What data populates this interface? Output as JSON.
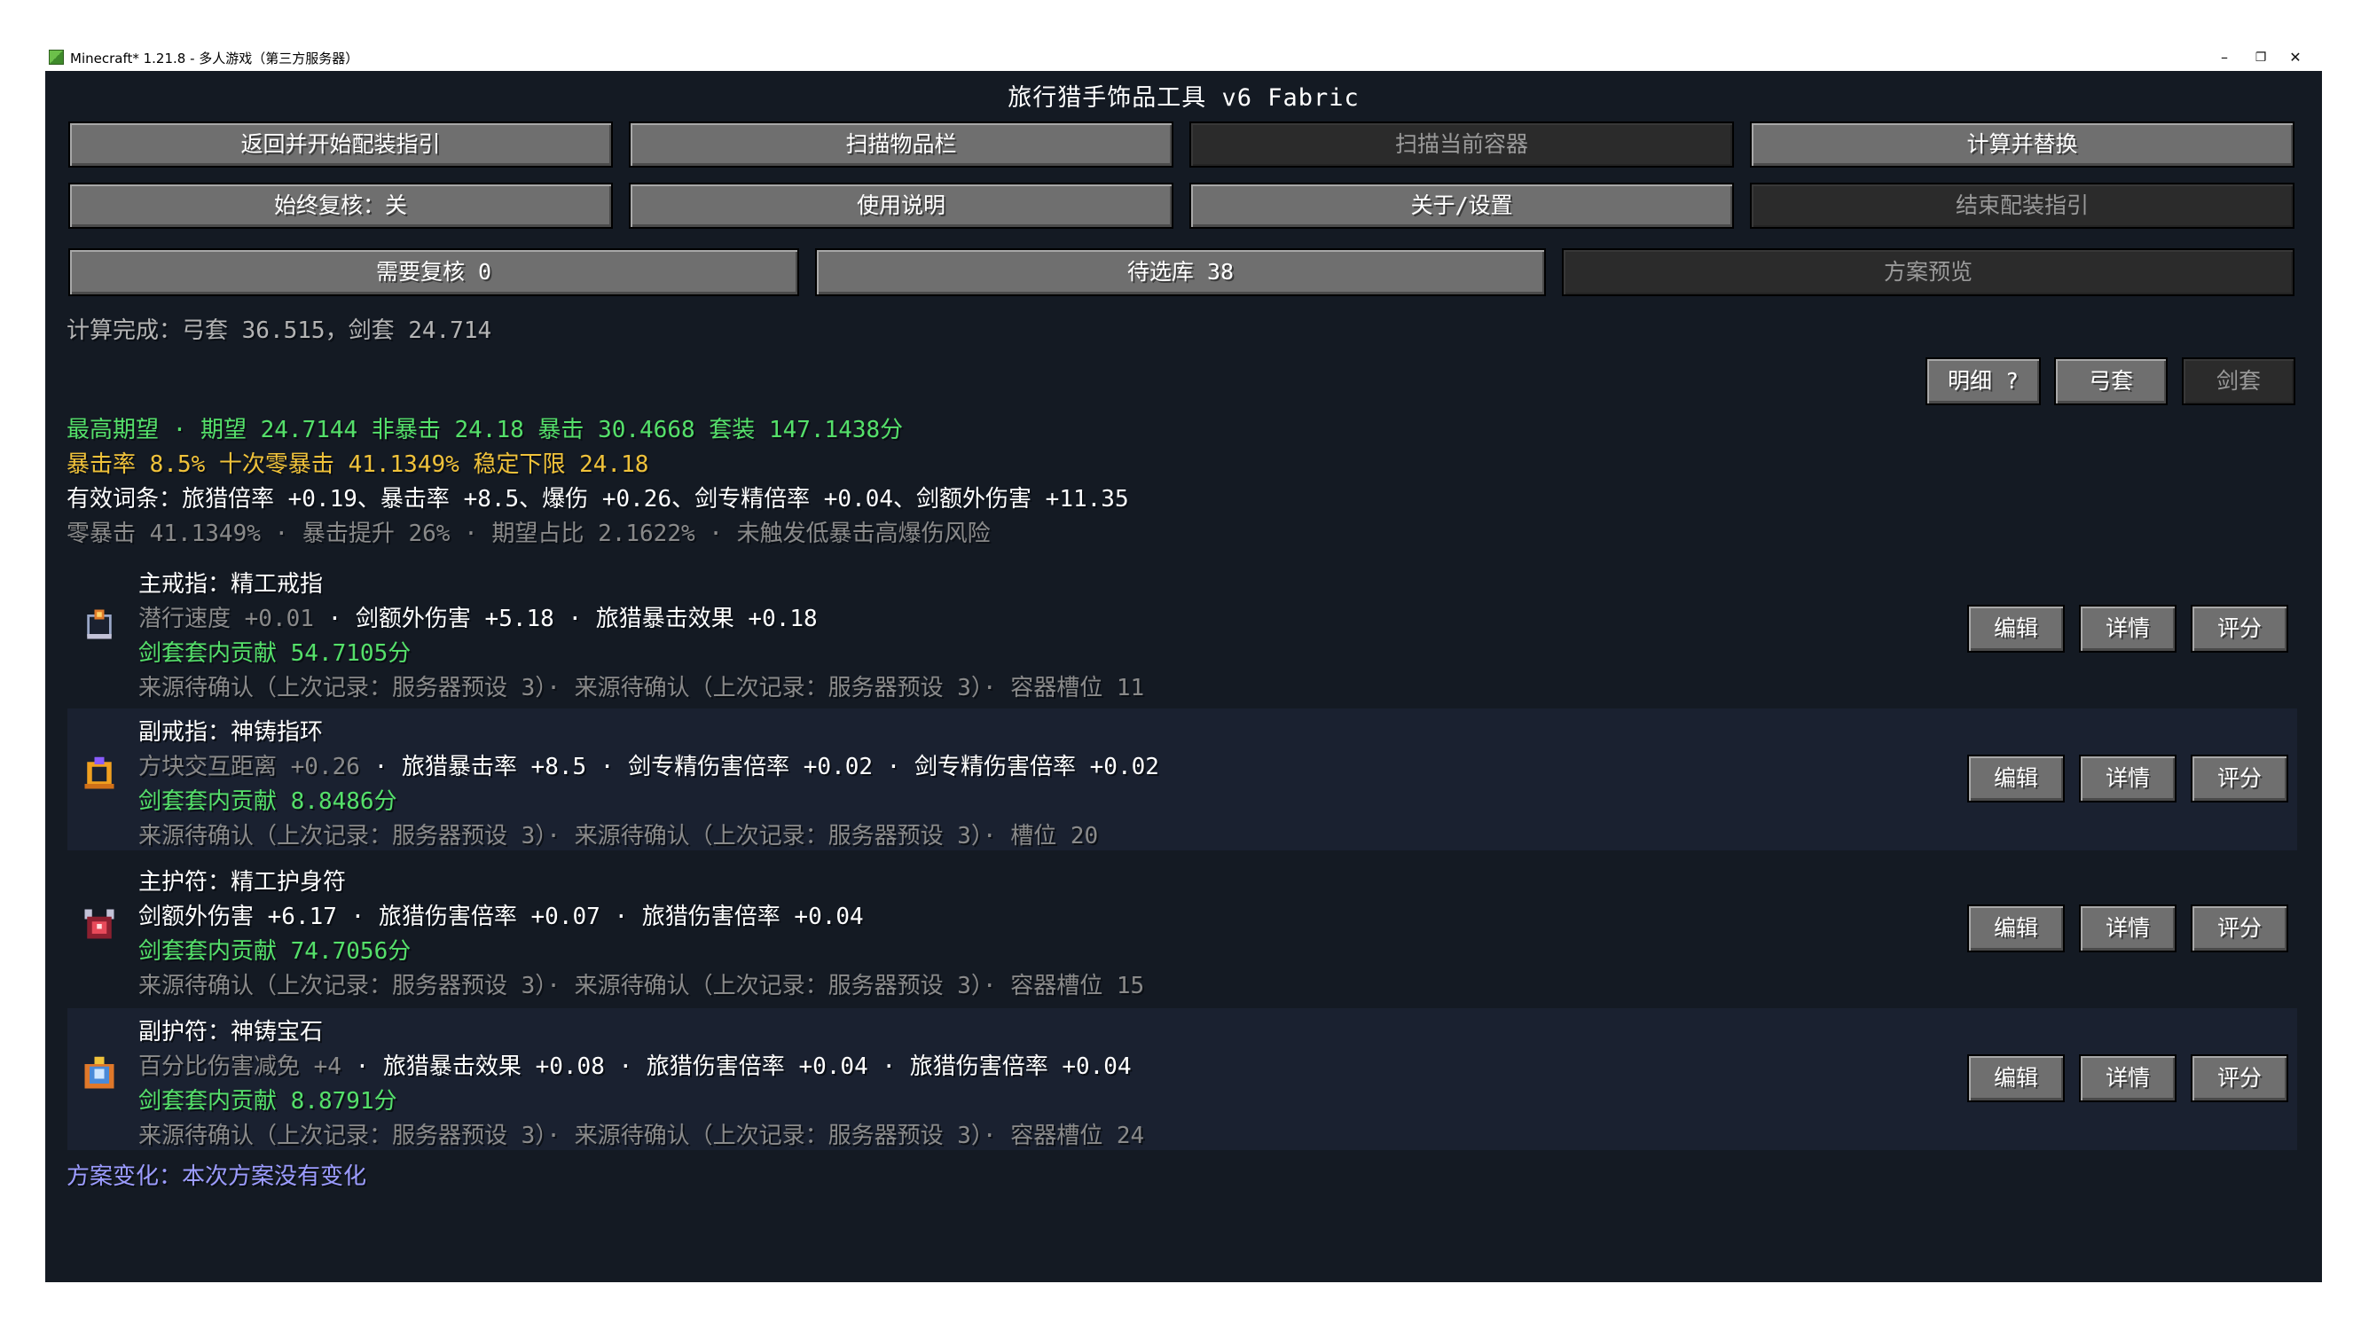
{
  "window": {
    "title": "Minecraft* 1.21.8 - 多人游戏（第三方服务器）",
    "minimize": "–",
    "restore": "❐",
    "close": "✕"
  },
  "screen": {
    "title": "旅行猎手饰品工具 v6 Fabric"
  },
  "buttons": {
    "return_guide": "返回并开始配装指引",
    "scan_inventory": "扫描物品栏",
    "scan_container": "扫描当前容器",
    "calc_replace": "计算并替换",
    "always_review": "始终复核：关",
    "usage": "使用说明",
    "about_settings": "关于/设置",
    "end_guide": "结束配装指引",
    "need_review": "需要复核 0",
    "candidates": "待选库 38",
    "plan_preview": "方案预览",
    "detail": "明细 ?",
    "bow_set": "弓套",
    "sword_set": "剑套"
  },
  "status": {
    "calc_done": "计算完成：弓套 36.515，剑套 24.714"
  },
  "summary": {
    "line1": "最高期望 · 期望 24.7144  非暴击 24.18  暴击 30.4668  套装 147.1438分",
    "line2": "暴击率 8.5%  十次零暴击 41.1349%  稳定下限 24.18",
    "line3": "有效词条：旅猎倍率 +0.19、暴击率 +8.5、爆伤 +0.26、剑专精倍率 +0.04、剑额外伤害 +11.35",
    "line4": "零暴击 41.1349% · 暴击提升 26% · 期望占比 2.1622% · 未触发低暴击高爆伤风险"
  },
  "item_actions": {
    "edit": "编辑",
    "details": "详情",
    "score": "评分"
  },
  "items": [
    {
      "slot": "主戒指：精工戒指",
      "stat_dim": "潜行速度 +0.01",
      "stats": " · 剑额外伤害 +5.18 · 旅猎暴击效果 +0.18",
      "contribution": "剑套套内贡献 54.7105分",
      "source": "来源待确认（上次记录：服务器预设 3）· 来源待确认（上次记录：服务器预设 3）· 容器槽位 11",
      "icon": "precision-ring-icon"
    },
    {
      "slot": "副戒指：神铸指环",
      "stat_dim": "方块交互距离 +0.26",
      "stats": " · 旅猎暴击率 +8.5 · 剑专精伤害倍率 +0.02 · 剑专精伤害倍率 +0.02",
      "contribution": "剑套套内贡献 8.8486分",
      "source": "来源待确认（上次记录：服务器预设 3）· 来源待确认（上次记录：服务器预设 3）· 槽位 20",
      "icon": "divine-ring-icon"
    },
    {
      "slot": "主护符：精工护身符",
      "stat_dim": "",
      "stats": "剑额外伤害 +6.17 · 旅猎伤害倍率 +0.07 · 旅猎伤害倍率 +0.04",
      "contribution": "剑套套内贡献 74.7056分",
      "source": "来源待确认（上次记录：服务器预设 3）· 来源待确认（上次记录：服务器预设 3）· 容器槽位 15",
      "icon": "precision-amulet-icon"
    },
    {
      "slot": "副护符：神铸宝石",
      "stat_dim": "百分比伤害减免 +4",
      "stats": " · 旅猎暴击效果 +0.08 · 旅猎伤害倍率 +0.04 · 旅猎伤害倍率 +0.04",
      "contribution": "剑套套内贡献 8.8791分",
      "source": "来源待确认（上次记录：服务器预设 3）· 来源待确认（上次记录：服务器预设 3）· 容器槽位 24",
      "icon": "divine-gem-icon"
    }
  ],
  "footer": {
    "plan_change": "方案变化：本次方案没有变化"
  }
}
